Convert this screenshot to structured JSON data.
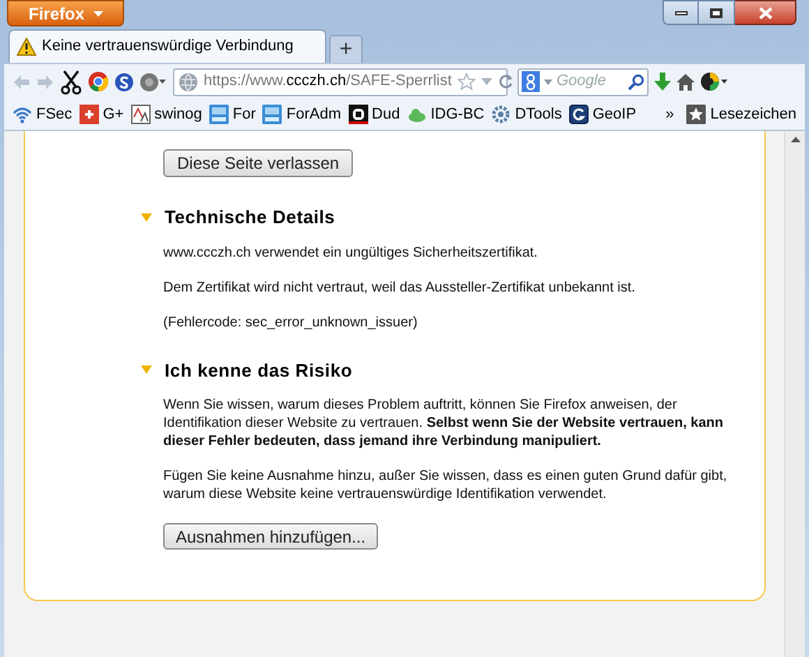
{
  "window": {
    "app_button": "Firefox"
  },
  "tabs": [
    {
      "title": "Keine vertrauenswürdige Verbindung",
      "selected": true
    }
  ],
  "new_tab": "+",
  "toolbar": {
    "url": "https://www.**ccczh.ch**/SAFE-Sperrlist",
    "search_placeholder": "Google"
  },
  "bookmarks": [
    {
      "label": "FSec"
    },
    {
      "label": "G+"
    },
    {
      "label": "swinog"
    },
    {
      "label": "For"
    },
    {
      "label": "ForAdm"
    },
    {
      "label": "Dud"
    },
    {
      "label": "IDG-BC"
    },
    {
      "label": "DTools"
    },
    {
      "label": "GeoIP"
    }
  ],
  "bookmarks_overflow": "»",
  "bookmarks_menu": "Lesezeichen",
  "page": {
    "leave_button": "Diese Seite verlassen",
    "sections": [
      {
        "title": "Technische Details",
        "expanded": true,
        "paragraphs": [
          "www.ccczh.ch verwendet ein ungültiges Sicherheitszertifikat.",
          "Dem Zertifikat wird nicht vertraut, weil das Aussteller-Zertifikat unbekannt ist.",
          "(Fehlercode: sec_error_unknown_issuer)"
        ]
      },
      {
        "title": "Ich kenne das Risiko",
        "expanded": true,
        "paragraphs": [
          "Wenn Sie wissen, warum dieses Problem auftritt, können Sie Firefox anweisen, der Identifikation dieser Website zu vertrauen. **Selbst wenn Sie der Website vertrauen, kann dieser Fehler bedeuten, dass jemand ihre Verbindung manipuliert.**",
          "Fügen Sie keine Ausnahme hinzu, außer Sie wissen, dass es einen guten Grund dafür gibt, warum diese Website keine vertrauenswürdige Identifikation verwendet."
        ],
        "button": "Ausnahmen hinzufügen..."
      }
    ]
  }
}
